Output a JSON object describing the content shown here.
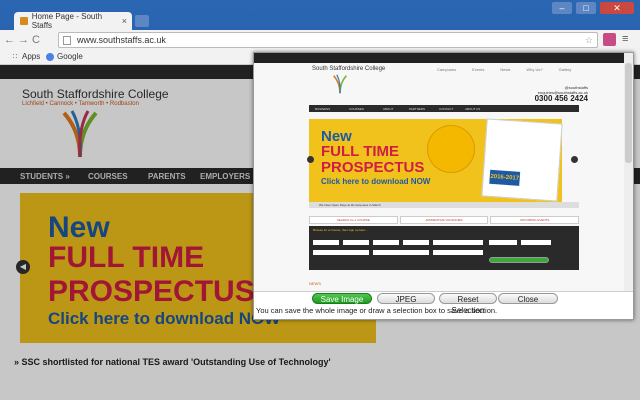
{
  "browser": {
    "tab_title": "Home Page - South Staffs",
    "tab_close": "×",
    "url": "www.southstaffs.ac.uk",
    "window_buttons": [
      "–",
      "□",
      "✕"
    ],
    "bookmarks": [
      "Apps",
      "Google"
    ]
  },
  "page": {
    "college_name": "South Staffordshire College",
    "towns": "Lichfield • Cannock • Tamworth • Rodbaston",
    "nav": [
      "STUDENTS »",
      "COURSES",
      "PARENTS",
      "EMPLOYERS »"
    ],
    "hero": {
      "line1": "New",
      "line2": "FULL TIME",
      "line3": "PROSPECTUS",
      "line4": "Click here to download NOW"
    },
    "news_headline": "» SSC shortlisted for national TES award 'Outstanding Use of Technology'"
  },
  "preview": {
    "college_name": "South Staffordshire College",
    "top_links": [
      "Campuses",
      "Events",
      "News",
      "Why Us?",
      "Gallery"
    ],
    "contact": [
      "@southstaffs",
      "enquiries@southstaffs.ac.uk"
    ],
    "phone": "0300 456 2424",
    "nav": [
      "BUSINESS",
      "COURSES",
      "ABOUT",
      "PARTNERS",
      "CONTACT",
      "ABOUT US"
    ],
    "hero": {
      "line1": "New",
      "line2": "FULL TIME",
      "line3": "PROSPECTUS",
      "line4": "Click here to download NOW",
      "year": "2016-2017"
    },
    "banner": "We have Open Days at all campuses in March",
    "tabs": [
      "SEARCH for a COURSE",
      "APPRENTICE VACANCIES",
      "UPCOMING EVENTS"
    ],
    "form_title": "Browse for a Course, then sign up here...",
    "news_label": "NEWS"
  },
  "actions": {
    "save": "Save Image",
    "jpeg": "JPEG",
    "reset": "Reset Selection",
    "close": "Close",
    "hint": "You can save the whole image or draw a selection box to save a section."
  }
}
